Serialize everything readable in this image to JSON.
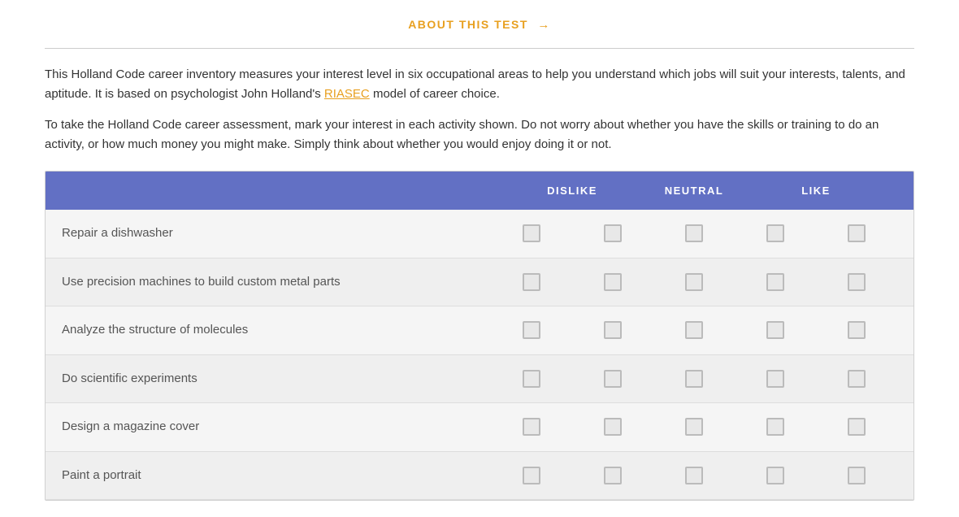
{
  "header": {
    "about_test_label": "ABOUT THIS TEST",
    "arrow": "→"
  },
  "intro": {
    "paragraph1": "This Holland Code career inventory measures your interest level in six occupational areas to help you understand which jobs will suit your interests, talents, and aptitude. It is based on psychologist John Holland's ",
    "riasec_text": "RIASEC",
    "paragraph1_end": " model of career choice.",
    "paragraph2": "To take the Holland Code career assessment, mark your interest in each activity shown. Do not worry about whether you have the skills or training to do an activity, or how much money you might make. Simply think about whether you would enjoy doing it or not."
  },
  "table": {
    "columns": {
      "dislike_label": "DISLIKE",
      "neutral_label": "NEUTRAL",
      "like_label": "LIKE"
    },
    "activities": [
      "Repair a dishwasher",
      "Use precision machines to build custom metal parts",
      "Analyze the structure of molecules",
      "Do scientific experiments",
      "Design a magazine cover",
      "Paint a portrait"
    ]
  }
}
